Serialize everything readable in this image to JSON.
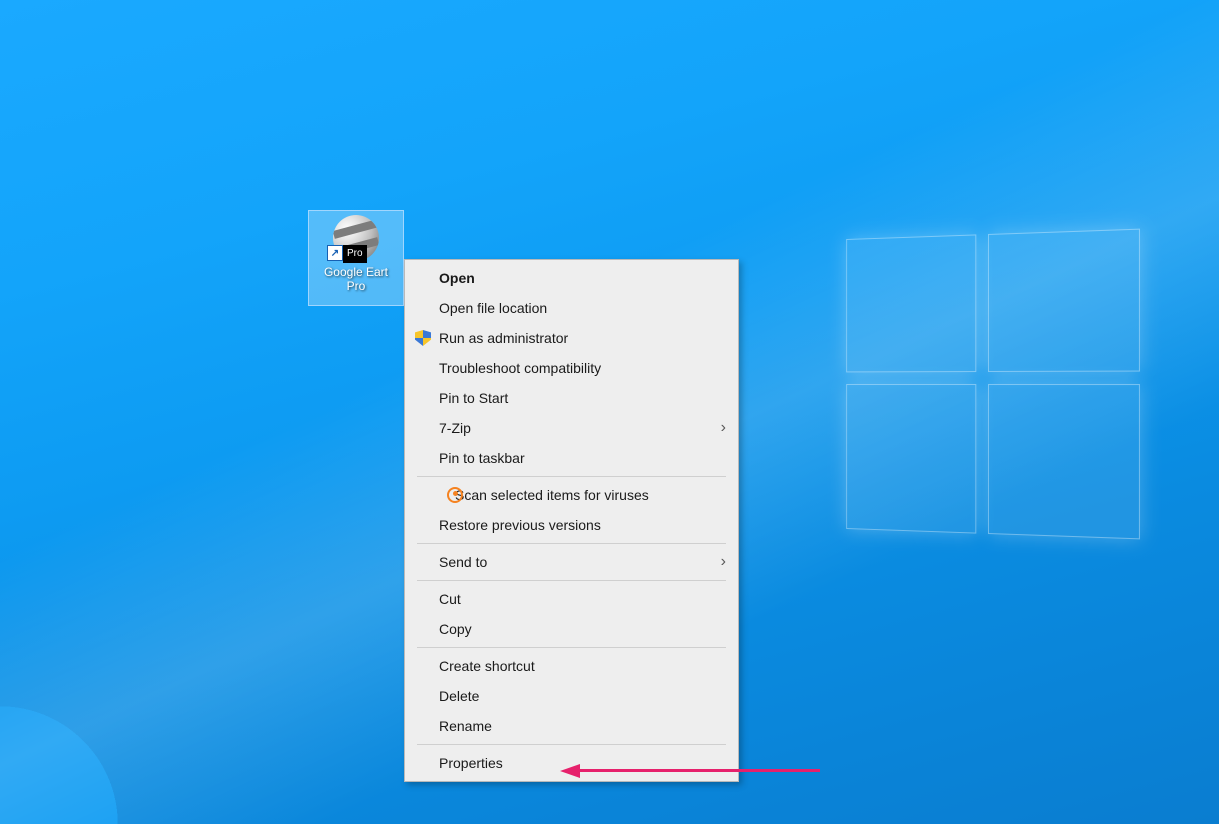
{
  "icon": {
    "badge": "Pro",
    "label_line1": "Google Eart",
    "label_line2": "Pro",
    "shortcut_glyph": "↗"
  },
  "menu": {
    "open": "Open",
    "open_loc": "Open file location",
    "run_admin": "Run as administrator",
    "troubleshoot": "Troubleshoot compatibility",
    "pin_start": "Pin to Start",
    "sevenzip": "7-Zip",
    "pin_taskbar": "Pin to taskbar",
    "scan": "Scan selected items for viruses",
    "restore": "Restore previous versions",
    "sendto": "Send to",
    "cut": "Cut",
    "copy": "Copy",
    "create_shortcut": "Create shortcut",
    "delete": "Delete",
    "rename": "Rename",
    "properties": "Properties",
    "submenu_glyph": "›"
  }
}
